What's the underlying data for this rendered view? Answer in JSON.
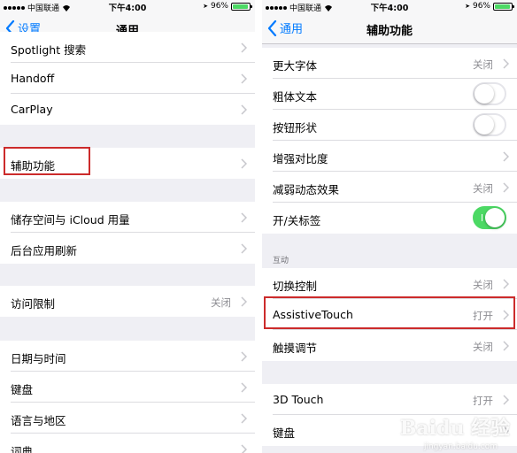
{
  "status_bar": {
    "carrier": "中国联通",
    "time": "下午4:00",
    "battery": "96%"
  },
  "left": {
    "back_label": "设置",
    "title": "通用",
    "rows": [
      {
        "label": "Spotlight 搜索",
        "value": ""
      },
      {
        "label": "Handoff",
        "value": ""
      },
      {
        "label": "CarPlay",
        "value": ""
      },
      {
        "label": "辅助功能",
        "value": ""
      },
      {
        "label": "储存空间与 iCloud 用量",
        "value": ""
      },
      {
        "label": "后台应用刷新",
        "value": ""
      },
      {
        "label": "访问限制",
        "value": "关闭"
      },
      {
        "label": "日期与时间",
        "value": ""
      },
      {
        "label": "键盘",
        "value": ""
      },
      {
        "label": "语言与地区",
        "value": ""
      },
      {
        "label": "词典",
        "value": ""
      }
    ]
  },
  "right": {
    "back_label": "通用",
    "title": "辅助功能",
    "section_interaction": "互动",
    "rows": [
      {
        "label": "更大字体",
        "value": "关闭"
      },
      {
        "label": "粗体文本",
        "toggle": false
      },
      {
        "label": "按钮形状",
        "toggle": false
      },
      {
        "label": "增强对比度",
        "value": ""
      },
      {
        "label": "减弱动态效果",
        "value": "关闭"
      },
      {
        "label": "开/关标签",
        "toggle": true
      },
      {
        "label": "切换控制",
        "value": "关闭"
      },
      {
        "label": "AssistiveTouch",
        "value": "打开"
      },
      {
        "label": "触摸调节",
        "value": "关闭"
      },
      {
        "label": "3D Touch",
        "value": "打开"
      },
      {
        "label": "键盘",
        "value": ""
      }
    ]
  },
  "colors": {
    "accent": "#007aff",
    "toggle_on": "#4cd964",
    "highlight": "#cc2b2b",
    "background": "#efeff4"
  },
  "watermark": {
    "brand": "Baidu 经验",
    "url": "jingyan.baidu.com"
  }
}
